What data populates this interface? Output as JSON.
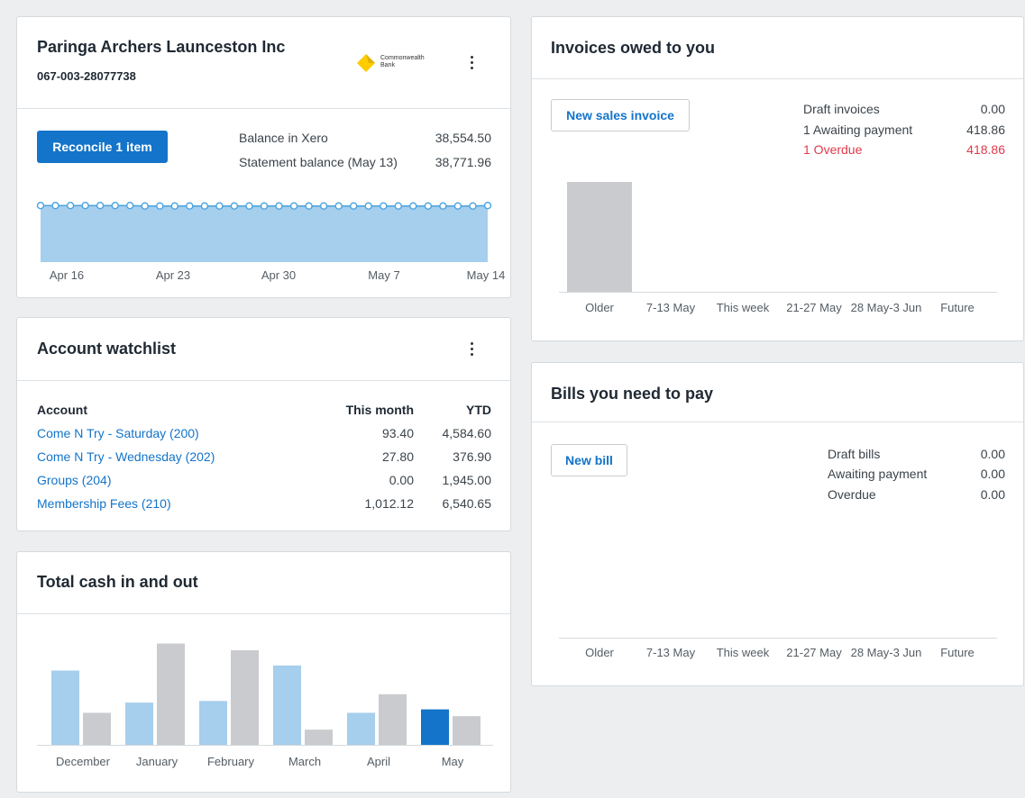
{
  "bank_card": {
    "org_name": "Paringa Archers Launceston Inc",
    "account_number": "067-003-28077738",
    "bank_logo_text_line1": "Commonwealth",
    "bank_logo_text_line2": "Bank",
    "reconcile_label": "Reconcile 1 item",
    "balance_xero_label": "Balance in Xero",
    "balance_xero_value": "38,554.50",
    "statement_label": "Statement balance (May 13)",
    "statement_value": "38,771.96",
    "x_labels": [
      "Apr 16",
      "Apr 23",
      "Apr 30",
      "May 7",
      "May 14"
    ],
    "colors": {
      "area": "#a6ceed",
      "line": "#4aa3df"
    }
  },
  "watchlist": {
    "title": "Account watchlist",
    "col_account": "Account",
    "col_month": "This month",
    "col_ytd": "YTD",
    "rows": [
      {
        "account": "Come N Try - Saturday (200)",
        "month": "93.40",
        "ytd": "4,584.60"
      },
      {
        "account": "Come N Try - Wednesday (202)",
        "month": "27.80",
        "ytd": "376.90"
      },
      {
        "account": "Groups (204)",
        "month": "0.00",
        "ytd": "1,945.00"
      },
      {
        "account": "Membership Fees (210)",
        "month": "1,012.12",
        "ytd": "6,540.65"
      }
    ]
  },
  "cash": {
    "title": "Total cash in and out",
    "colors": {
      "in": "#a6ceed",
      "out": "#c9cbce",
      "current": "#1374c9"
    }
  },
  "invoices": {
    "title": "Invoices owed to you",
    "new_label": "New sales invoice",
    "draft_label": "Draft invoices",
    "draft_value": "0.00",
    "awaiting_label": "1 Awaiting payment",
    "awaiting_value": "418.86",
    "overdue_label": "1 Overdue",
    "overdue_value": "418.86",
    "overdue_color": "#e03a4a"
  },
  "bills": {
    "title": "Bills you need to pay",
    "new_label": "New bill",
    "draft_label": "Draft bills",
    "draft_value": "0.00",
    "awaiting_label": "Awaiting payment",
    "awaiting_value": "0.00",
    "overdue_label": "Overdue",
    "overdue_value": "0.00"
  },
  "chart_data": [
    {
      "type": "area",
      "title": "",
      "x_tick_labels": [
        "Apr 16",
        "Apr 23",
        "Apr 30",
        "May 7",
        "May 14"
      ],
      "note": "nearly flat balance series",
      "series": [
        {
          "values": [
            38554,
            38554,
            38554,
            38554,
            38554,
            38554,
            38554,
            38550,
            38550,
            38550,
            38550,
            38550,
            38550,
            38550,
            38550,
            38550,
            38550,
            38550,
            38550,
            38550,
            38550,
            38550,
            38550,
            38550,
            38550,
            38550,
            38550,
            38550,
            38550,
            38550,
            38554
          ]
        }
      ]
    },
    {
      "type": "bar",
      "title": "Total cash in and out",
      "categories": [
        "December",
        "January",
        "February",
        "March",
        "April",
        "May"
      ],
      "series": [
        {
          "values": [
            2200,
            1250,
            1300,
            2350,
            950,
            1050
          ]
        },
        {
          "values": [
            950,
            3000,
            2800,
            450,
            1500,
            850
          ]
        }
      ],
      "ylim": [
        0,
        3200
      ]
    },
    {
      "type": "bar",
      "title": "Invoices owed to you",
      "categories": [
        "Older",
        "7-13 May",
        "This week",
        "21-27 May",
        "28 May-3 Jun",
        "Future"
      ],
      "values": [
        418.86,
        0,
        0,
        0,
        0,
        0
      ]
    },
    {
      "type": "bar",
      "title": "Bills you need to pay",
      "categories": [
        "Older",
        "7-13 May",
        "This week",
        "21-27 May",
        "28 May-3 Jun",
        "Future"
      ],
      "values": [
        0,
        0,
        0,
        0,
        0,
        0
      ]
    }
  ]
}
